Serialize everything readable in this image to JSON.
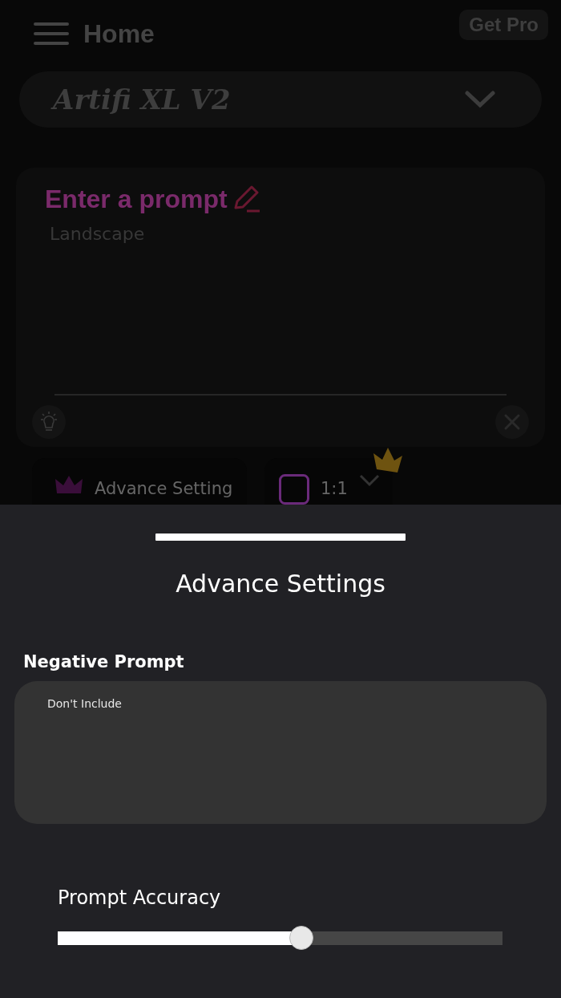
{
  "header": {
    "title": "Home",
    "pro_button": "Get Pro"
  },
  "model_picker": {
    "value": "Artifi XL V2"
  },
  "prompt_card": {
    "heading": "Enter a prompt",
    "value": "Landscape"
  },
  "options": [
    {
      "kind": "settings",
      "label": "Advance Setting"
    },
    {
      "kind": "ratio",
      "label": "1:1"
    }
  ],
  "sheet": {
    "title": "Advance Settings",
    "negative_prompt": {
      "label": "Negative Prompt",
      "placeholder": "Don't Include"
    },
    "accuracy": {
      "label": "Prompt Accuracy",
      "level": 0.55
    }
  }
}
